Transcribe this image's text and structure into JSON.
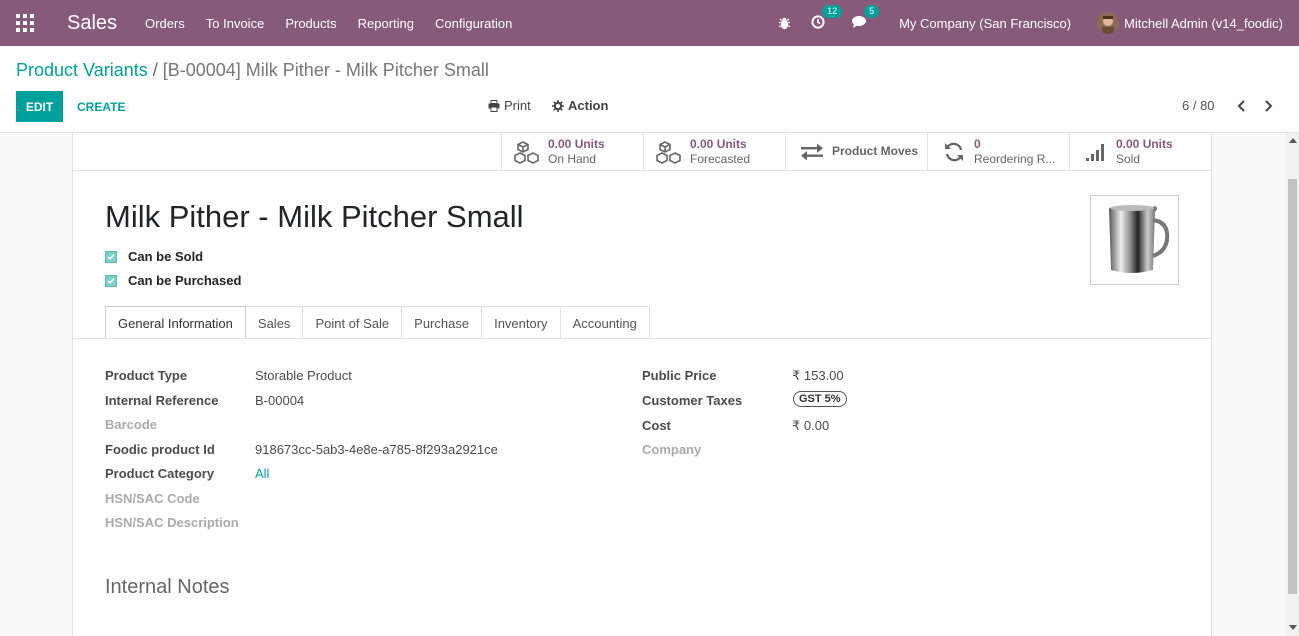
{
  "navbar": {
    "app_name": "Sales",
    "menu": [
      "Orders",
      "To Invoice",
      "Products",
      "Reporting",
      "Configuration"
    ],
    "activity_count": "12",
    "message_count": "5",
    "company": "My Company (San Francisco)",
    "user": "Mitchell Admin (v14_foodic)",
    "icons": [
      "apps-grid-icon",
      "bug-icon",
      "clock-icon",
      "chat-icon"
    ],
    "bg_color": "#875a7b"
  },
  "breadcrumb": {
    "parent": "Product Variants",
    "separator": "/",
    "current": "[B-00004] Milk Pither - Milk Pitcher Small"
  },
  "control": {
    "edit_label": "EDIT",
    "create_label": "CREATE",
    "print_label": "Print",
    "action_label": "Action",
    "pager": "6 / 80"
  },
  "smart_buttons": [
    {
      "value": "0.00 Units",
      "label": "On Hand",
      "icon": "cubes-icon"
    },
    {
      "value": "0.00 Units",
      "label": "Forecasted",
      "icon": "cubes-icon"
    },
    {
      "value": "",
      "label": "Product Moves",
      "icon": "exchange-icon"
    },
    {
      "value": "0",
      "label": "Reordering R...",
      "icon": "refresh-icon"
    },
    {
      "value": "0.00 Units",
      "label": "Sold",
      "icon": "signal-icon"
    }
  ],
  "product": {
    "name": "Milk Pither - Milk Pitcher Small",
    "can_be_sold_label": "Can be Sold",
    "can_be_sold": true,
    "can_be_purchased_label": "Can be Purchased",
    "can_be_purchased": true
  },
  "tabs": [
    "General Information",
    "Sales",
    "Point of Sale",
    "Purchase",
    "Inventory",
    "Accounting"
  ],
  "active_tab": "General Information",
  "left_fields": [
    {
      "label": "Product Type",
      "value": "Storable Product"
    },
    {
      "label": "Internal Reference",
      "value": "B-00004"
    },
    {
      "label": "Barcode",
      "value": ""
    },
    {
      "label": "Foodic product Id",
      "value": "918673cc-5ab3-4e8e-a785-8f293a2921ce"
    },
    {
      "label": "Product Category",
      "value": "All"
    },
    {
      "label": "HSN/SAC Code",
      "value": ""
    },
    {
      "label": "HSN/SAC Description",
      "value": ""
    }
  ],
  "right_fields": [
    {
      "label": "Public Price",
      "value": "₹ 153.00"
    },
    {
      "label": "Customer Taxes",
      "value": "GST 5%"
    },
    {
      "label": "Cost",
      "value": "₹ 0.00"
    },
    {
      "label": "Company",
      "value": ""
    }
  ],
  "internal_notes_title": "Internal Notes",
  "accent_color": "#00a09d"
}
